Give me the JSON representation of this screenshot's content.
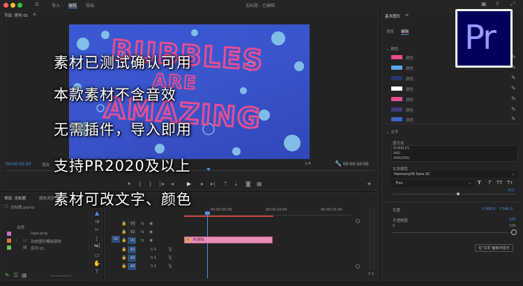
{
  "titlebar": {
    "title": "无标题 - 已编辑",
    "tabs": [
      "导入",
      "编辑",
      "导出"
    ],
    "active_tab": "编辑"
  },
  "program_monitor": {
    "header": "节目: 序列 01",
    "timecode_left": "00:00:02:20",
    "fit_label": "适合",
    "quality": "1/4",
    "timecode_right": "00:00:10:00"
  },
  "video_text": [
    "BUBBLES",
    "ARE",
    "AMAZING"
  ],
  "overlay_lines": [
    "素材已测试确认可用",
    "本款素材不含音效",
    "无需插件，导入即用",
    "支持PR2020及以上",
    "素材可改文字、颜色"
  ],
  "essential_graphics": {
    "title": "基本图形",
    "tabs": [
      "浏览",
      "编辑"
    ],
    "active_tab": "编辑",
    "color_section": "颜色",
    "colors": [
      {
        "hex": "#e94d8f",
        "label": "颜色"
      },
      {
        "hex": "#5aa8e6",
        "label": "颜色"
      },
      {
        "hex": "#27356f",
        "label": "颜色"
      },
      {
        "hex": "#ffffff",
        "label": "颜色"
      },
      {
        "hex": "#e94d8f",
        "label": "颜色"
      },
      {
        "hex": "#3b3d7a",
        "label": "颜色"
      },
      {
        "hex": "#3d66c6",
        "label": "颜色"
      }
    ],
    "text_section": "文字",
    "source_text_label": "源文本",
    "source_text": [
      "BUBBLES",
      "ARE",
      "AMAZING"
    ],
    "text_props_label": "文本属性",
    "font": "HarmonyOS Sans SC",
    "style": "Thin",
    "size_value": "312",
    "position_label": "位置",
    "pos_x": "X 960.0",
    "pos_y": "Y 540.0",
    "opacity_label": "不透明度",
    "opacity_value": "100",
    "opacity_min": "0",
    "opacity_max": "100",
    "footer_button": "在\"文本\"面板中显示",
    "style_buttons": [
      "T",
      "T",
      "TT",
      "Tт"
    ]
  },
  "project": {
    "title": "项目: 无标题",
    "tab2": "媒体浏览",
    "file": "无标题.prproj",
    "name_col": "名称",
    "items": [
      "logo.png",
      "动态图形模板媒体",
      "序列 01"
    ]
  },
  "timeline": {
    "ruler": [
      "00:00:05:00",
      "00:00:10:00",
      "00:00:15:00"
    ],
    "tracks_video": [
      "V3",
      "V2",
      "V1"
    ],
    "tracks_audio": [
      "A1",
      "A2",
      "A3"
    ],
    "source_patch": "V1",
    "clip_label": "BUBBL",
    "meter_label": "S S"
  },
  "pr_logo": "Pr"
}
